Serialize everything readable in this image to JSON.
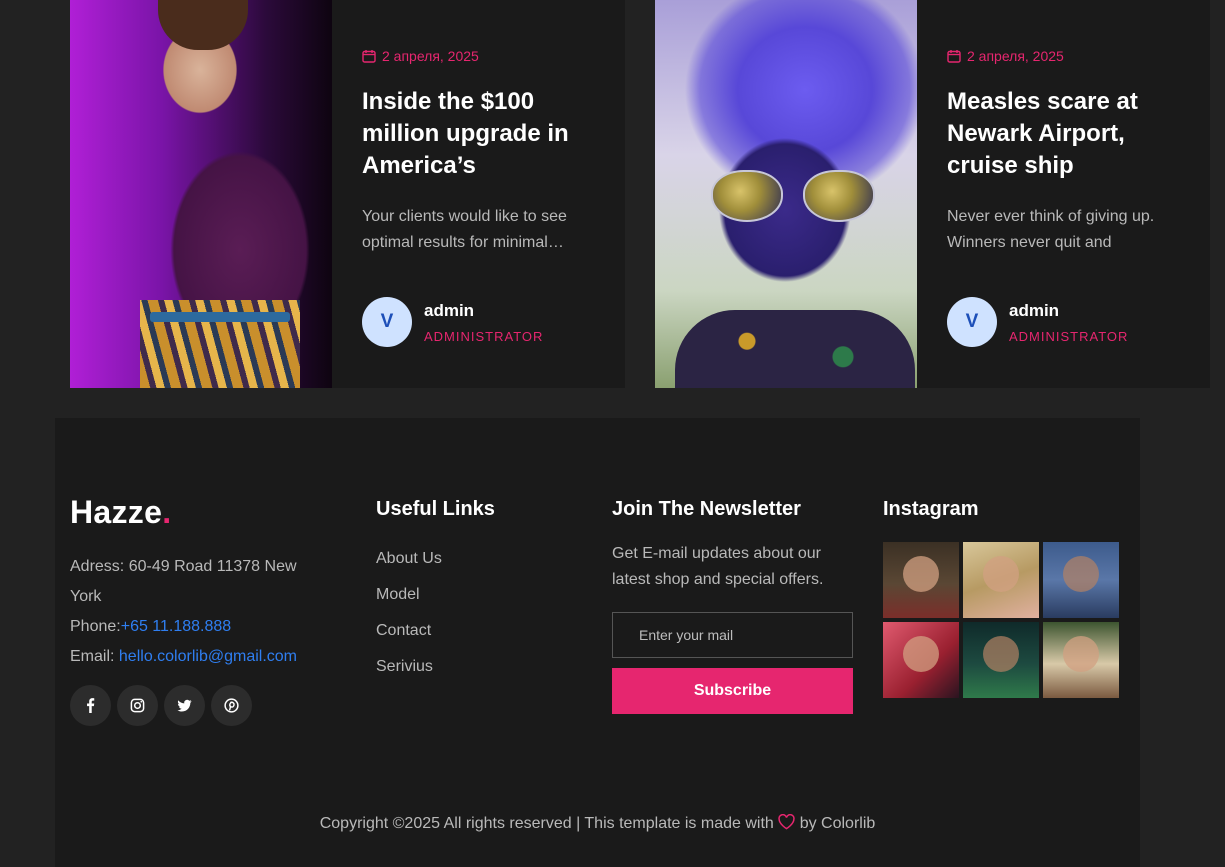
{
  "posts": [
    {
      "date": "2 апреля, 2025",
      "title": "Inside the $100 million upgrade in America’s",
      "excerpt": "Your clients would like to see optimal results for minimal…",
      "author": {
        "initial": "V",
        "name": "admin",
        "role": "ADMINISTRATOR"
      }
    },
    {
      "date": "2 апреля, 2025",
      "title": "Measles scare at Newark Airport, cruise ship",
      "excerpt": "Never ever think of giving up. Winners never quit and",
      "author": {
        "initial": "V",
        "name": "admin",
        "role": "ADMINISTRATOR"
      }
    }
  ],
  "footer": {
    "logo": {
      "text": "Hazze",
      "dot": "."
    },
    "contact": {
      "address_label": "Adress:",
      "address": "60-49 Road 11378 New York",
      "phone_label": "Phone:",
      "phone": "+65 11.188.888",
      "email_label": "Email:",
      "email": "hello.colorlib@gmail.com"
    },
    "socials": [
      "facebook-icon",
      "instagram-icon",
      "twitter-icon",
      "pinterest-icon"
    ],
    "useful_links": {
      "title": "Useful Links",
      "items": [
        "About Us",
        "Model",
        "Contact",
        "Serivius"
      ]
    },
    "newsletter": {
      "title": "Join The Newsletter",
      "text": "Get E-mail updates about our latest shop and special offers.",
      "placeholder": "Enter your mail",
      "button": "Subscribe"
    },
    "instagram": {
      "title": "Instagram"
    },
    "copyright": {
      "before": "Copyright ©2025 All rights reserved | This template is made with ",
      "after": " by Colorlib"
    }
  },
  "colors": {
    "accent": "#e6266f",
    "link": "#2f7ef0",
    "background": "#222222",
    "panel": "#1a1a1a"
  }
}
